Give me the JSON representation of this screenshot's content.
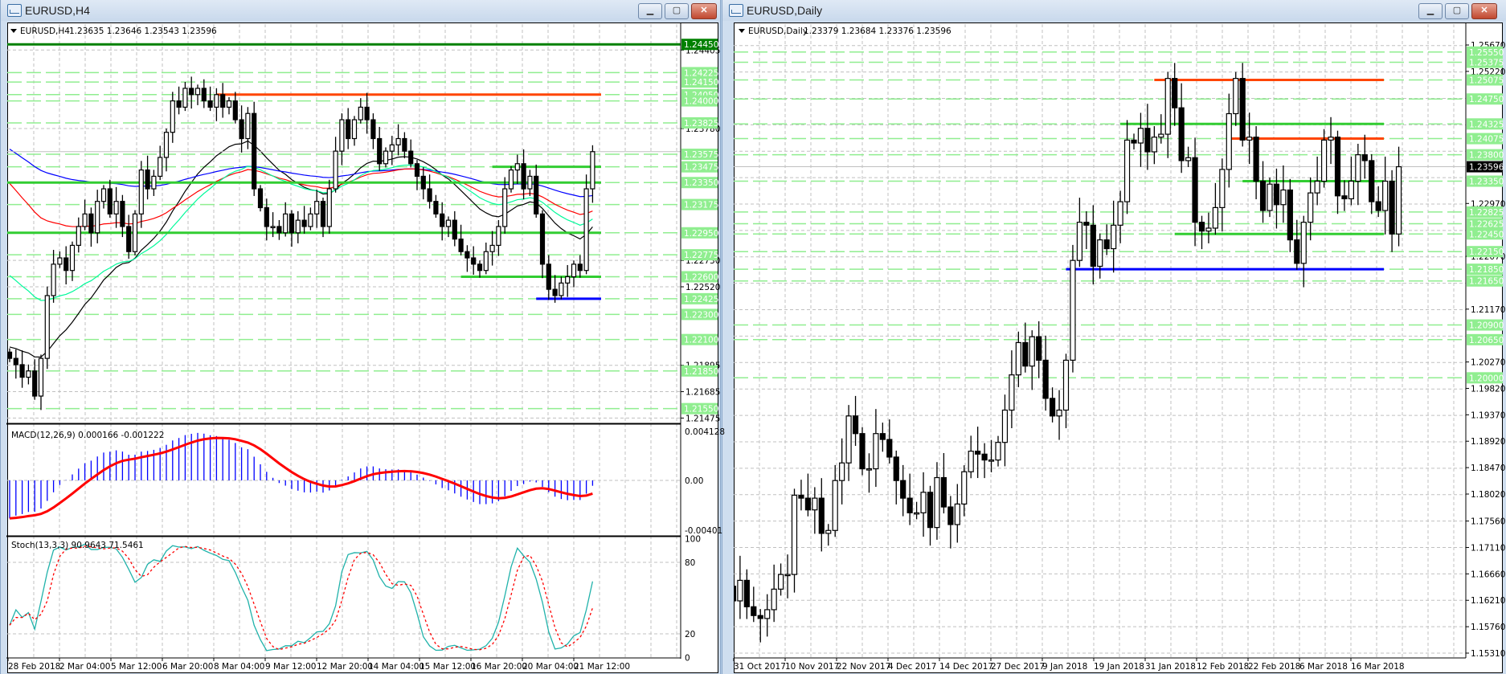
{
  "left_window": {
    "title": "EURUSD,H4",
    "buttons": {
      "minimize": "▁",
      "maximize": "▢",
      "close": "✕"
    },
    "header_symbol": "EURUSD,H4",
    "header_ohlc": "1.23635 1.23646 1.23543 1.23596",
    "macd_label": "MACD(12,26,9) 0.000166 -0.001222",
    "stoch_label": "Stoch(13,3,3) 90.9643 71.5461",
    "macd_axis": [
      "0.004128",
      "0.00",
      "-0.00401"
    ],
    "stoch_axis": [
      "100",
      "80",
      "20",
      "0"
    ],
    "price_labels": [
      "1.24405",
      "1.23780",
      "1.22730",
      "1.22520",
      "1.21895",
      "1.21685",
      "1.21475"
    ],
    "level_labels": [
      "1.24225",
      "1.24150",
      "1.24050",
      "1.24000",
      "1.23825",
      "1.23575",
      "1.23475",
      "1.23350",
      "1.23175",
      "1.22950",
      "1.22775",
      "1.22600",
      "1.22425",
      "1.22300",
      "1.22100",
      "1.21850",
      "1.21550"
    ],
    "key_level_label": "1.24450",
    "time_labels": [
      "28 Feb 2018",
      "2 Mar 04:00",
      "5 Mar 12:00",
      "6 Mar 20:00",
      "8 Mar 04:00",
      "9 Mar 12:00",
      "12 Mar 20:00",
      "14 Mar 04:00",
      "15 Mar 12:00",
      "16 Mar 20:00",
      "20 Mar 04:00",
      "21 Mar 12:00"
    ]
  },
  "right_window": {
    "title": "EURUSD,Daily",
    "buttons": {
      "minimize": "▁",
      "maximize": "▢",
      "close": "✕"
    },
    "header_symbol": "EURUSD,Daily",
    "header_ohlc": "1.23379 1.23684 1.23376 1.23596",
    "current_price": "1.23596",
    "price_labels": [
      "1.25670",
      "1.25220",
      "1.22970",
      "1.22070",
      "1.21170",
      "1.20270",
      "1.19820",
      "1.19370",
      "1.18920",
      "1.18470",
      "1.18020",
      "1.17560",
      "1.17110",
      "1.16660",
      "1.16210",
      "1.15760",
      "1.15310"
    ],
    "level_labels": [
      "1.25550",
      "1.25375",
      "1.25075",
      "1.24750",
      "1.24325",
      "1.24075",
      "1.23800",
      "1.23350",
      "1.22825",
      "1.22625",
      "1.22450",
      "1.22150",
      "1.21850",
      "1.21650",
      "1.20900",
      "1.20650",
      "1.20000"
    ],
    "time_labels": [
      "31 Oct 2017",
      "10 Nov 2017",
      "22 Nov 2017",
      "4 Dec 2017",
      "14 Dec 2017",
      "27 Dec 2017",
      "9 Jan 2018",
      "19 Jan 2018",
      "31 Jan 2018",
      "12 Feb 2018",
      "22 Feb 2018",
      "6 Mar 2018",
      "16 Mar 2018"
    ]
  },
  "colors": {
    "support": "#32cd32",
    "resistance": "#ff4500",
    "key_low": "#0000ff",
    "key_high": "#008000",
    "level_label_bg": "#90ee90",
    "macd_hist": "#0000ff",
    "macd_signal": "#ff0000",
    "stoch_main": "#20b2aa",
    "stoch_signal": "#ff0000"
  },
  "chart_data": [
    {
      "type": "candlestick",
      "title": "EURUSD,H4",
      "ylim": [
        1.21475,
        1.2455
      ],
      "first_open": 1.22,
      "closes": [
        1.2195,
        1.219,
        1.218,
        1.2185,
        1.2165,
        1.2195,
        1.2245,
        1.227,
        1.2275,
        1.2265,
        1.2285,
        1.23,
        1.231,
        1.2295,
        1.232,
        1.233,
        1.231,
        1.232,
        1.23,
        1.228,
        1.231,
        1.2345,
        1.233,
        1.234,
        1.2355,
        1.2375,
        1.24,
        1.2395,
        1.241,
        1.2405,
        1.241,
        1.24,
        1.2395,
        1.2405,
        1.2395,
        1.24,
        1.2385,
        1.237,
        1.239,
        1.233,
        1.2315,
        1.23,
        1.23,
        1.2295,
        1.231,
        1.2295,
        1.2305,
        1.23,
        1.231,
        1.232,
        1.23,
        1.233,
        1.236,
        1.2385,
        1.237,
        1.2385,
        1.2395,
        1.2385,
        1.237,
        1.235,
        1.236,
        1.2365,
        1.237,
        1.236,
        1.235,
        1.234,
        1.233,
        1.232,
        1.231,
        1.23,
        1.2305,
        1.229,
        1.228,
        1.2275,
        1.227,
        1.2265,
        1.228,
        1.2285,
        1.23,
        1.233,
        1.2345,
        1.235,
        1.233,
        1.234,
        1.231,
        1.227,
        1.225,
        1.2245,
        1.2255,
        1.226,
        1.227,
        1.2265,
        1.233,
        1.23596
      ],
      "moving_averages": [
        {
          "period": 21,
          "seed": 1.2205,
          "color": "#000000"
        },
        {
          "period": 100,
          "seed": 1.2365,
          "color": "#0000ff"
        },
        {
          "period": 50,
          "seed": 1.234,
          "color": "#ff0000"
        },
        {
          "period": 34,
          "seed": 1.2265,
          "color": "#00fa9a"
        }
      ],
      "levels": [
        {
          "price": 1.2445,
          "kind": "key_high",
          "from_bar": 0
        },
        {
          "price": 1.2405,
          "kind": "resistance",
          "from_bar": 33
        },
        {
          "price": 1.23475,
          "kind": "support",
          "from_bar": 77
        },
        {
          "price": 1.2335,
          "kind": "support",
          "from_bar": 0
        },
        {
          "price": 1.2295,
          "kind": "support",
          "from_bar": 0
        },
        {
          "price": 1.226,
          "kind": "support",
          "from_bar": 72
        },
        {
          "price": 1.22425,
          "kind": "key_low",
          "from_bar": 84
        }
      ],
      "macd": {
        "fast": 12,
        "slow": 26,
        "signal": 9,
        "seed_fast": 1.219,
        "seed_slow": 1.2225,
        "ylim": [
          -0.00401,
          0.004128
        ]
      },
      "stochastic": {
        "k": 13,
        "d": 3,
        "slowing": 3,
        "ylim": [
          0,
          100
        ],
        "levels": [
          20,
          80
        ]
      }
    },
    {
      "type": "candlestick",
      "title": "EURUSD,Daily",
      "ylim": [
        1.1531,
        1.2567
      ],
      "first_open": 1.166,
      "closes": [
        1.1645,
        1.162,
        1.1655,
        1.161,
        1.1595,
        1.159,
        1.1605,
        1.164,
        1.1665,
        1.1665,
        1.18,
        1.1795,
        1.1775,
        1.1795,
        1.1735,
        1.174,
        1.1825,
        1.1855,
        1.1935,
        1.1905,
        1.1845,
        1.1845,
        1.1905,
        1.1895,
        1.1865,
        1.1825,
        1.1795,
        1.177,
        1.177,
        1.1805,
        1.1745,
        1.183,
        1.178,
        1.175,
        1.1785,
        1.184,
        1.1875,
        1.187,
        1.186,
        1.186,
        1.189,
        1.1945,
        1.2005,
        1.206,
        1.202,
        1.207,
        1.203,
        1.1965,
        1.1935,
        1.1945,
        1.203,
        1.22,
        1.2265,
        1.226,
        1.219,
        1.2235,
        1.222,
        1.226,
        1.23,
        1.2405,
        1.24,
        1.2425,
        1.2385,
        1.241,
        1.2415,
        1.251,
        1.246,
        1.237,
        1.2375,
        1.2265,
        1.225,
        1.2255,
        1.229,
        1.2355,
        1.245,
        1.251,
        1.2405,
        1.241,
        1.2335,
        1.2285,
        1.233,
        1.2295,
        1.232,
        1.2235,
        1.2195,
        1.2265,
        1.2315,
        1.2335,
        1.2405,
        1.241,
        1.231,
        1.2305,
        1.2335,
        1.238,
        1.237,
        1.23,
        1.2285,
        1.2335,
        1.2245,
        1.23596
      ],
      "levels": [
        {
          "price": 1.25075,
          "kind": "resistance",
          "from_bar": 63
        },
        {
          "price": 1.24325,
          "kind": "support",
          "from_bar": 58
        },
        {
          "price": 1.24075,
          "kind": "resistance",
          "from_bar": 74
        },
        {
          "price": 1.2335,
          "kind": "support",
          "from_bar": 76
        },
        {
          "price": 1.2245,
          "kind": "support",
          "from_bar": 66
        },
        {
          "price": 1.2185,
          "kind": "key_low",
          "from_bar": 50
        }
      ]
    }
  ]
}
